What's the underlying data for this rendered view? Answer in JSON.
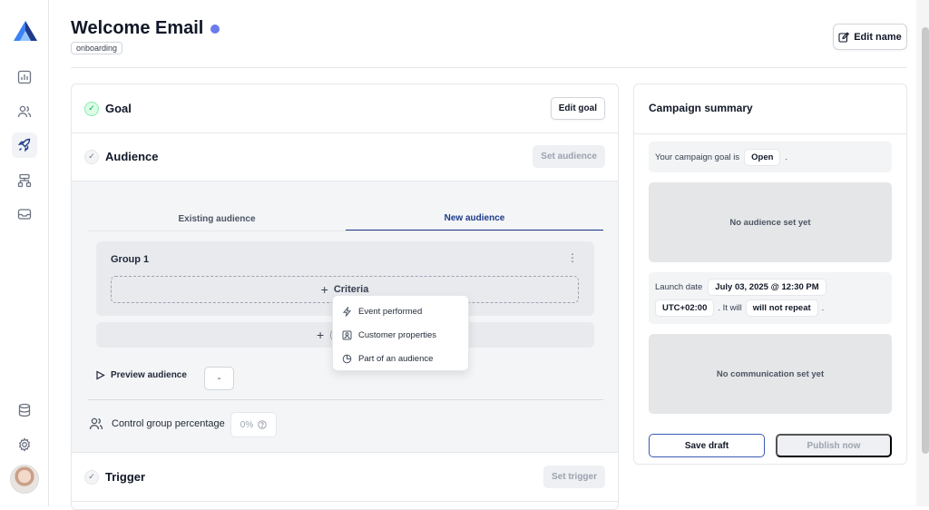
{
  "sidebar": {
    "logo": "brand-logo",
    "items": [
      {
        "icon": "chart-icon",
        "active": false
      },
      {
        "icon": "users-icon",
        "active": false
      },
      {
        "icon": "rocket-icon",
        "active": true
      },
      {
        "icon": "flow-icon",
        "active": false
      },
      {
        "icon": "inbox-icon",
        "active": false
      }
    ],
    "bottom": [
      {
        "icon": "database-icon"
      },
      {
        "icon": "gear-icon"
      }
    ]
  },
  "header": {
    "title": "Welcome Email",
    "status_color": "#6b7bf0",
    "tag": "onboarding",
    "edit_name_label": "Edit name"
  },
  "steps": {
    "goal": {
      "label": "Goal",
      "button": "Edit goal"
    },
    "audience": {
      "label": "Audience",
      "button": "Set audience",
      "tabs": [
        "Existing audience",
        "New audience"
      ],
      "active_tab": 1,
      "group_title": "Group 1",
      "criteria_label": "Criteria",
      "add_group_label": "+",
      "add_group_partial": "+",
      "add_group_text": "(",
      "dropdown": [
        "Event performed",
        "Customer properties",
        "Part of an audience"
      ],
      "preview_label": "Preview audience",
      "preview_value": "-",
      "control_label": "Control group percentage",
      "control_value": "0%"
    },
    "trigger": {
      "label": "Trigger",
      "button": "Set trigger"
    }
  },
  "summary": {
    "title": "Campaign summary",
    "goal_prefix": "Your campaign goal is",
    "goal_value": "Open",
    "goal_suffix": ".",
    "no_audience": "No audience set yet",
    "launch_prefix": "Launch date",
    "launch_value": "July 03, 2025 @ 12:30 PM",
    "timezone": "UTC+02:00",
    "repeat_prefix": ". It will",
    "repeat_value": "will not repeat",
    "repeat_suffix": ".",
    "no_communication": "No communication set yet",
    "save_label": "Save draft",
    "publish_label": "Publish now"
  },
  "colors": {
    "accent": "#1e3a8a",
    "check_green": "#22c55e"
  }
}
